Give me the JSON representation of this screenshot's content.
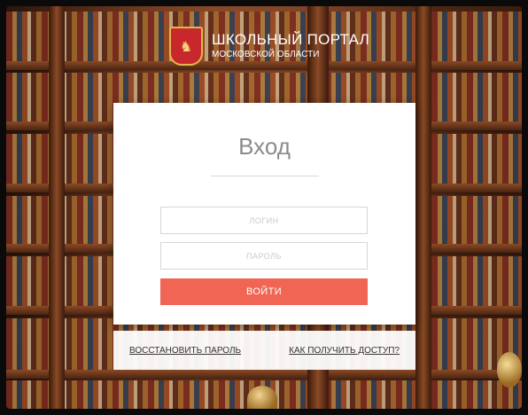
{
  "brand": {
    "title": "ШКОЛЬНЫЙ ПОРТАЛ",
    "subtitle": "МОСКОВСКОЙ ОБЛАСТИ",
    "crest_icon": "moscow-region-coat-of-arms-icon"
  },
  "login": {
    "heading": "Вход",
    "login_placeholder": "ЛОГИН",
    "password_placeholder": "ПАРОЛЬ",
    "submit_label": "ВОЙТИ"
  },
  "footer_links": {
    "restore_password": "ВОССТАНОВИТЬ ПАРОЛЬ",
    "get_access": "КАК ПОЛУЧИТЬ ДОСТУП?"
  },
  "colors": {
    "accent": "#f06553",
    "heading_gray": "#8b8b8b",
    "input_border": "#d6d6d6",
    "crest_red": "#c8282c"
  }
}
